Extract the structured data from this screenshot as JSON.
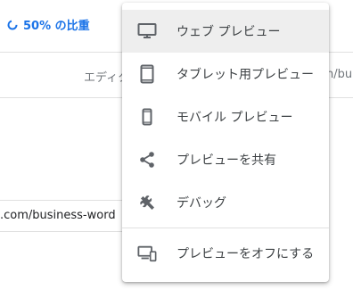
{
  "toolbar": {
    "zoom_label": "50% の比重"
  },
  "background": {
    "editor_label": "エディタ",
    "url_fragment_right": "n/bu",
    "url_text": ".com/business-word"
  },
  "menu": {
    "items": [
      {
        "label": "ウェブ プレビュー",
        "icon": "desktop-icon",
        "active": true
      },
      {
        "label": "タブレット用プレビュー",
        "icon": "tablet-icon"
      },
      {
        "label": "モバイル プレビュー",
        "icon": "phone-icon"
      },
      {
        "label": "プレビューを共有",
        "icon": "share-icon"
      },
      {
        "label": "デバッグ",
        "icon": "wrench-icon"
      },
      {
        "label": "プレビューをオフにする",
        "icon": "devices-off-icon"
      }
    ]
  },
  "colors": {
    "accent": "#1a73e8",
    "icon": "#5f6368",
    "active_bg": "#eeeeee"
  }
}
